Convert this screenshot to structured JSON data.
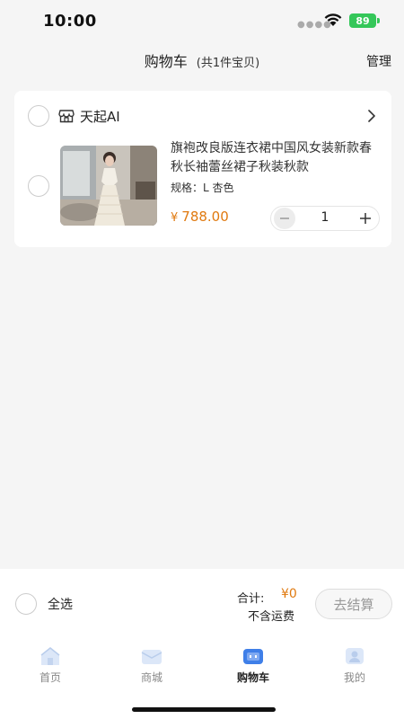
{
  "status": {
    "time": "10:00",
    "battery": "89"
  },
  "nav": {
    "title": "购物车",
    "count": "(共1件宝贝)",
    "manage": "管理"
  },
  "cart": {
    "store": {
      "name": "天起AI",
      "icon": "store-icon"
    },
    "item": {
      "title": "旗袍改良版连衣裙中国风女装新款春秋长袖蕾丝裙子秋装秋款",
      "spec": "规格：L 杏色",
      "price_symbol": "¥",
      "price": "788.00",
      "quantity": "1"
    }
  },
  "checkout": {
    "select_all": "全选",
    "total_label": "合计:",
    "total_value": "¥0",
    "shipping_note": "不含运费",
    "button": "去结算"
  },
  "tabs": [
    {
      "label": "首页",
      "icon": "home-icon"
    },
    {
      "label": "商城",
      "icon": "mall-icon"
    },
    {
      "label": "购物车",
      "icon": "cart-icon"
    },
    {
      "label": "我的",
      "icon": "profile-icon"
    }
  ],
  "colors": {
    "accent": "#e07a10",
    "battery": "#34c759",
    "cart_tab": "#3f7fe8"
  }
}
